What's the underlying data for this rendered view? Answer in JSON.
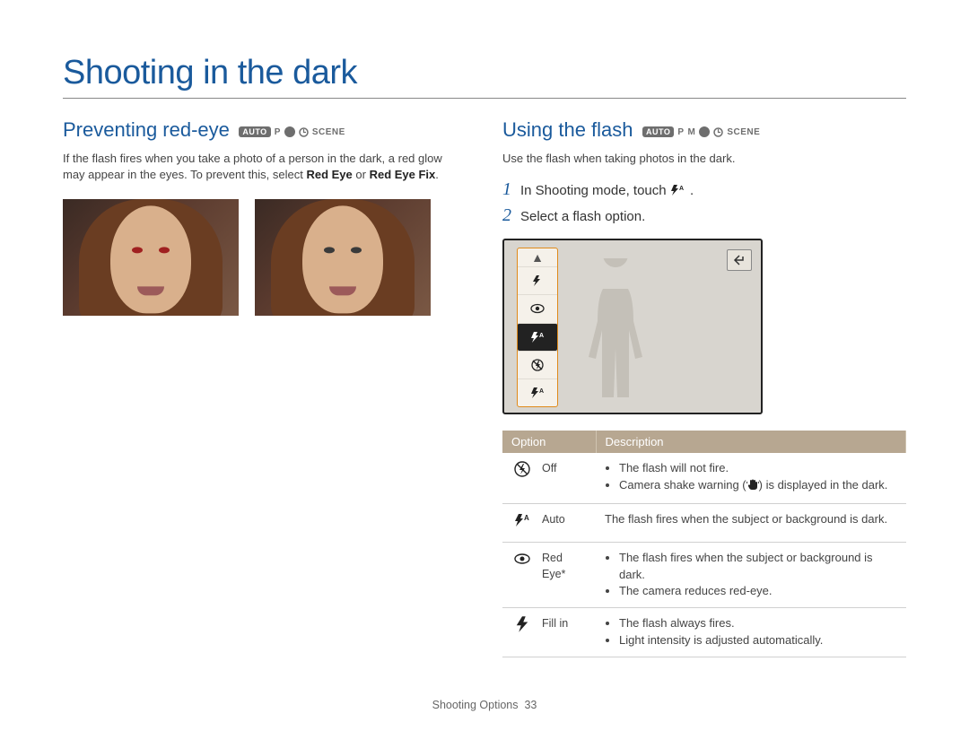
{
  "page_title": "Shooting in the dark",
  "left": {
    "heading": "Preventing red-eye",
    "modes": [
      "AUTO",
      "P",
      "dual",
      "SCENE"
    ],
    "intro_1": "If the flash fires when you take a photo of a person in the dark, a red glow may appear in the eyes. To prevent this, select ",
    "intro_bold_1": "Red Eye",
    "intro_or": " or ",
    "intro_bold_2": "Red Eye Fix",
    "intro_end": "."
  },
  "right": {
    "heading": "Using the flash",
    "modes": [
      "AUTO",
      "P",
      "M",
      "dual",
      "SCENE"
    ],
    "intro": "Use the flash when taking photos in the dark.",
    "step1_a": "In Shooting mode, touch ",
    "step1_b": ".",
    "step2": "Select a flash option.",
    "table_head_option": "Option",
    "table_head_desc": "Description",
    "rows": [
      {
        "icon": "flash-off-icon",
        "name": "Off",
        "desc_bullets": [
          "The flash will not fire.",
          "Camera shake warning (HAND) is displayed in the dark."
        ]
      },
      {
        "icon": "flash-auto-icon",
        "name": "Auto",
        "desc_plain": "The flash fires when the subject or background is dark."
      },
      {
        "icon": "flash-redeye-icon",
        "name": "Red Eye*",
        "desc_bullets": [
          "The flash fires when the subject or background is dark.",
          "The camera reduces red-eye."
        ]
      },
      {
        "icon": "flash-fillin-icon",
        "name": "Fill in",
        "desc_bullets": [
          "The flash always fires.",
          "Light intensity is adjusted automatically."
        ]
      }
    ]
  },
  "footer_section": "Shooting Options",
  "footer_page": "33"
}
